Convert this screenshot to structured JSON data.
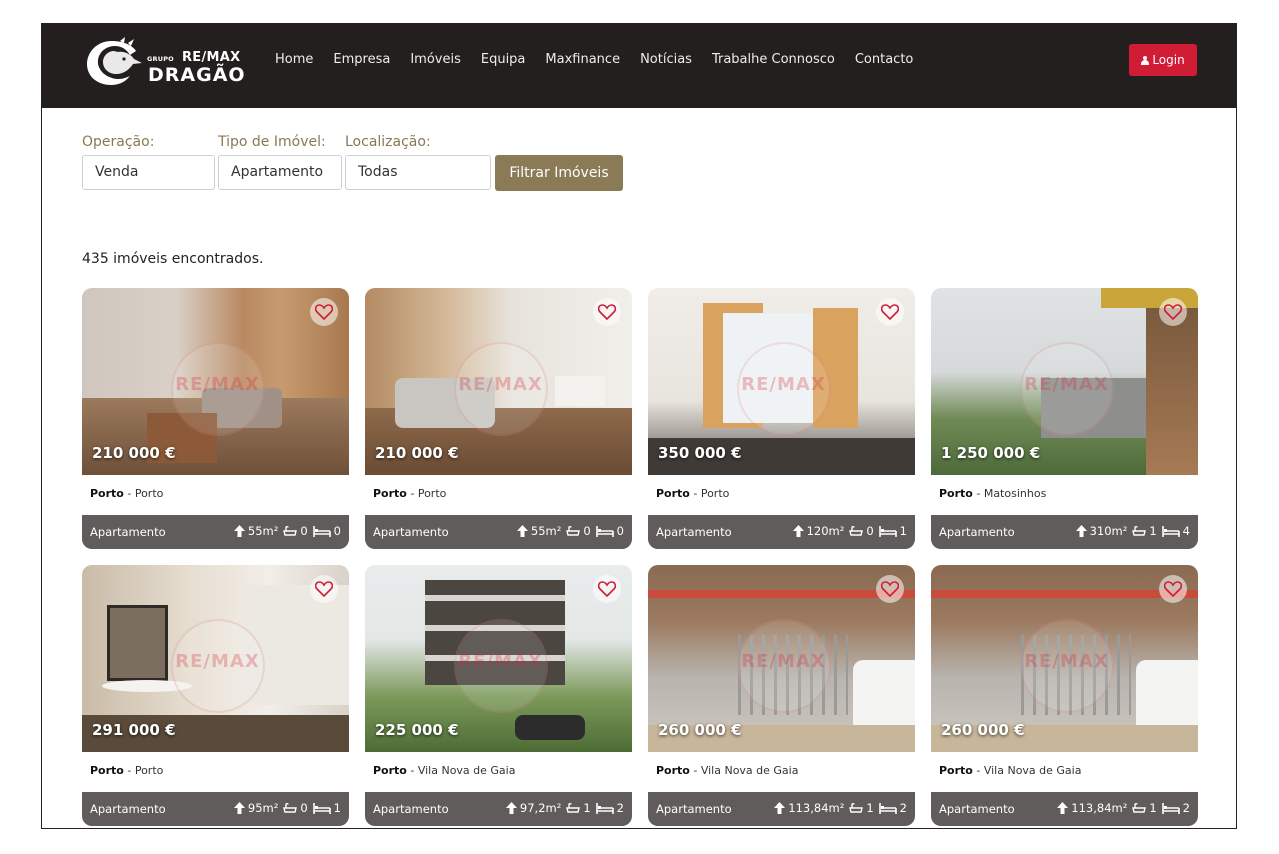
{
  "brand": {
    "grupo": "GRUPO",
    "remax": "RE/MAX",
    "dragao": "DRAGÃO"
  },
  "nav": [
    "Home",
    "Empresa",
    "Imóveis",
    "Equipa",
    "Maxfinance",
    "Notícias",
    "Trabalhe Connosco",
    "Contacto"
  ],
  "login_label": "Login",
  "filters": {
    "operacao_label": "Operação:",
    "operacao_value": "Venda",
    "tipo_label": "Tipo de Imóvel:",
    "tipo_value": "Apartamento",
    "localizacao_label": "Localização:",
    "localizacao_value": "Todas",
    "button": "Filtrar Imóveis"
  },
  "results_count": "435 imóveis encontrados.",
  "watermark": "RE/MAX",
  "listings": [
    {
      "price": "210 000 €",
      "district": "Porto",
      "city": "Porto",
      "type": "Apartamento",
      "area": "55m²",
      "baths": "0",
      "beds": "0"
    },
    {
      "price": "210 000 €",
      "district": "Porto",
      "city": "Porto",
      "type": "Apartamento",
      "area": "55m²",
      "baths": "0",
      "beds": "0"
    },
    {
      "price": "350 000 €",
      "district": "Porto",
      "city": "Porto",
      "type": "Apartamento",
      "area": "120m²",
      "baths": "0",
      "beds": "1"
    },
    {
      "price": "1 250 000 €",
      "district": "Porto",
      "city": "Matosinhos",
      "type": "Apartamento",
      "area": "310m²",
      "baths": "1",
      "beds": "4"
    },
    {
      "price": "291 000 €",
      "district": "Porto",
      "city": "Porto",
      "type": "Apartamento",
      "area": "95m²",
      "baths": "0",
      "beds": "1"
    },
    {
      "price": "225 000 €",
      "district": "Porto",
      "city": "Vila Nova de Gaia",
      "type": "Apartamento",
      "area": "97,2m²",
      "baths": "1",
      "beds": "2"
    },
    {
      "price": "260 000 €",
      "district": "Porto",
      "city": "Vila Nova de Gaia",
      "type": "Apartamento",
      "area": "113,84m²",
      "baths": "1",
      "beds": "2"
    },
    {
      "price": "260 000 €",
      "district": "Porto",
      "city": "Vila Nova de Gaia",
      "type": "Apartamento",
      "area": "113,84m²",
      "baths": "1",
      "beds": "2"
    }
  ],
  "colors": {
    "topbar": "#231f1e",
    "login": "#d11c35",
    "accent": "#8b7a56",
    "card_bar": "#5f5c5b",
    "heart": "#d11c35"
  }
}
